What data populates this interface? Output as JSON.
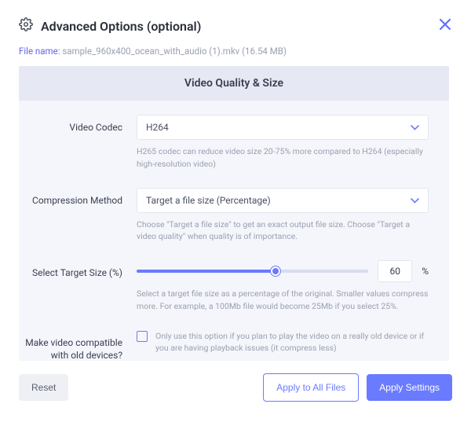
{
  "header": {
    "title": "Advanced Options (optional)"
  },
  "file": {
    "label": "File name: ",
    "value": "sample_960x400_ocean_with_audio (1).mkv (16.54 MB)"
  },
  "section": {
    "title": "Video Quality & Size"
  },
  "fields": {
    "codec": {
      "label": "Video Codec",
      "value": "H264",
      "hint": "H265 codec can reduce video size 20-75% more compared to H264 (especially high-resolution video)"
    },
    "compression": {
      "label": "Compression Method",
      "value": "Target a file size (Percentage)",
      "hint": "Choose \"Target a file size\" to get an exact output file size. Choose \"Target a video quality\" when quality is of importance."
    },
    "target": {
      "label": "Select Target Size (%)",
      "value": "60",
      "percent_symbol": "%",
      "hint": "Select a target file size as a percentage of the original. Smaller values compress more. For example, a 100Mb file would become 25Mb if you select 25%."
    },
    "compat": {
      "label": "Make video compatible with old devices?",
      "hint": "Only use this option if you plan to play the video on a really old device or if you are having playback issues (it compress less)"
    }
  },
  "footer": {
    "reset": "Reset",
    "apply_all": "Apply to All Files",
    "apply": "Apply Settings"
  }
}
